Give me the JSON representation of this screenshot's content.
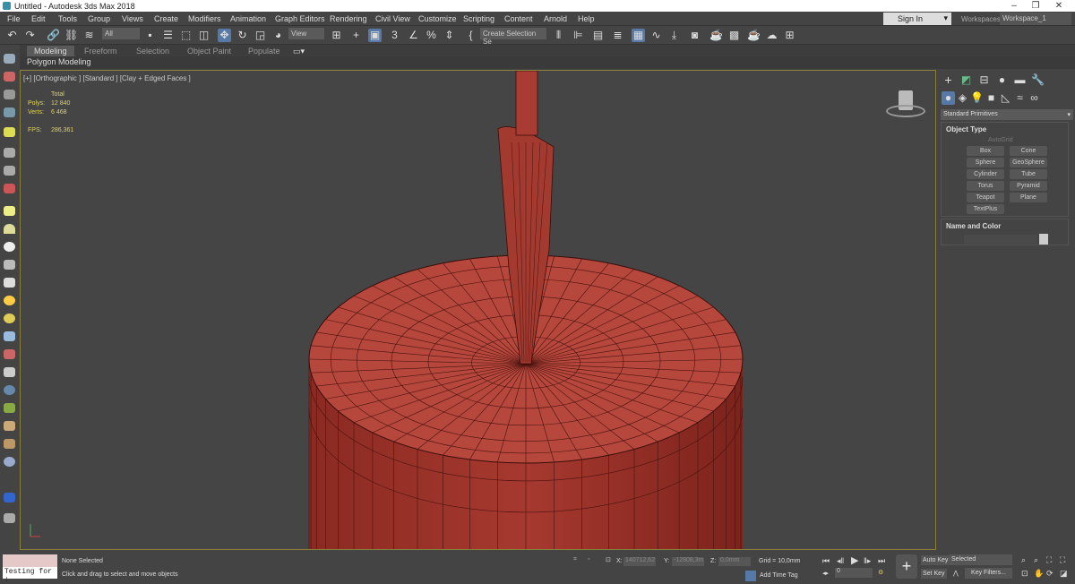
{
  "window": {
    "title": "Untitled - Autodesk 3ds Max 2018",
    "minimize": "–",
    "restore": "❐",
    "close": "✕"
  },
  "menu": [
    "File",
    "Edit",
    "Tools",
    "Group",
    "Views",
    "Create",
    "Modifiers",
    "Animation",
    "Graph Editors",
    "Rendering",
    "Civil View",
    "Customize",
    "Scripting",
    "Content",
    "Arnold",
    "Help"
  ],
  "account": {
    "sign_in": "Sign In",
    "workspaces_label": "Workspaces:",
    "workspace": "Workspace_1"
  },
  "toolbar": {
    "selection_filter": "All",
    "ref_coord": "View",
    "named_selection": "Create Selection Se"
  },
  "ribbon": {
    "tabs": [
      "Modeling",
      "Freeform",
      "Selection",
      "Object Paint",
      "Populate"
    ],
    "active_tab": "Modeling",
    "sub_label": "Polygon Modeling"
  },
  "viewport": {
    "label": "[+] [Orthographic ] [Standard ] [Clay + Edged Faces ]",
    "stats": {
      "total_label": "Total",
      "polys_label": "Polys:",
      "polys": "12 840",
      "verts_label": "Verts:",
      "verts": "6 468",
      "fps_label": "FPS:",
      "fps": "286,361"
    },
    "object_color": "#b5473c"
  },
  "command_panel": {
    "category": "Standard Primitives",
    "object_type_title": "Object Type",
    "autogrid": "AutoGrid",
    "buttons": [
      "Box",
      "Cone",
      "Sphere",
      "GeoSphere",
      "Cylinder",
      "Tube",
      "Torus",
      "Pyramid",
      "Teapot",
      "Plane",
      "TextPlus"
    ],
    "name_color_title": "Name and Color"
  },
  "status": {
    "script_input": "Testing for :",
    "selection": "None Selected",
    "prompt": "Click and drag to select and move objects",
    "x_label": "X:",
    "x": "140712,62",
    "y_label": "Y:",
    "y": "-12808,3m",
    "z_label": "Z:",
    "z": "0,0mm",
    "grid": "Grid = 10,0mm",
    "add_time_tag": "Add Time Tag",
    "frame": "0",
    "auto_key": "Auto Key",
    "set_key": "Set Key",
    "key_mode": "Selected",
    "key_filters": "Key Filters..."
  }
}
